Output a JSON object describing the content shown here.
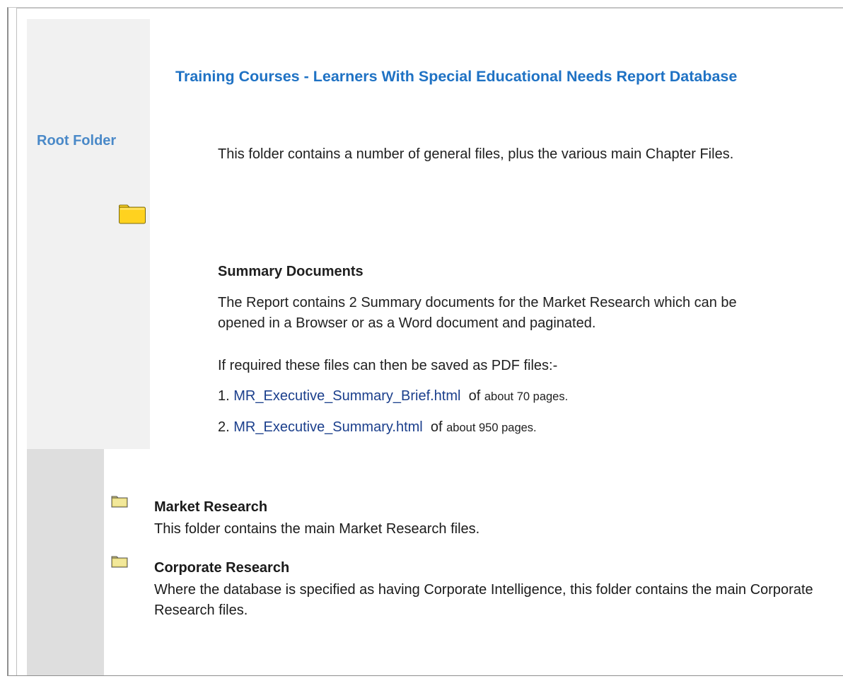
{
  "page": {
    "title": "Training Courses - Learners With Special Educational Needs Report Database"
  },
  "root": {
    "label": "Root Folder",
    "description": "This folder contains a number of general files, plus the various main Chapter Files."
  },
  "summary": {
    "heading": "Summary Documents",
    "description": "The Report contains 2 Summary documents for the Market Research which can be opened in a Browser or as a Word document and paginated.",
    "pdf_note": "If required these files can then be saved as PDF files:-",
    "documents": [
      {
        "number": "1.",
        "link": "MR_Executive_Summary_Brief.html",
        "of": "of",
        "pages": "about 70 pages."
      },
      {
        "number": "2.",
        "link": "MR_Executive_Summary.html",
        "of": "of",
        "pages": "about 950 pages."
      }
    ]
  },
  "folders": [
    {
      "name": "Market Research",
      "icon": "folder-icon",
      "description": "This folder contains the main Market Research files."
    },
    {
      "name": "Corporate Research",
      "icon": "folder-icon",
      "description": "Where the database is specified as having Corporate Intelligence, this folder contains the main Corporate Research files."
    }
  ],
  "colors": {
    "title": "#1f72c4",
    "root_label": "#4a89c8",
    "link": "#1b3f8c",
    "folder_yellow": "#ffd21f"
  }
}
